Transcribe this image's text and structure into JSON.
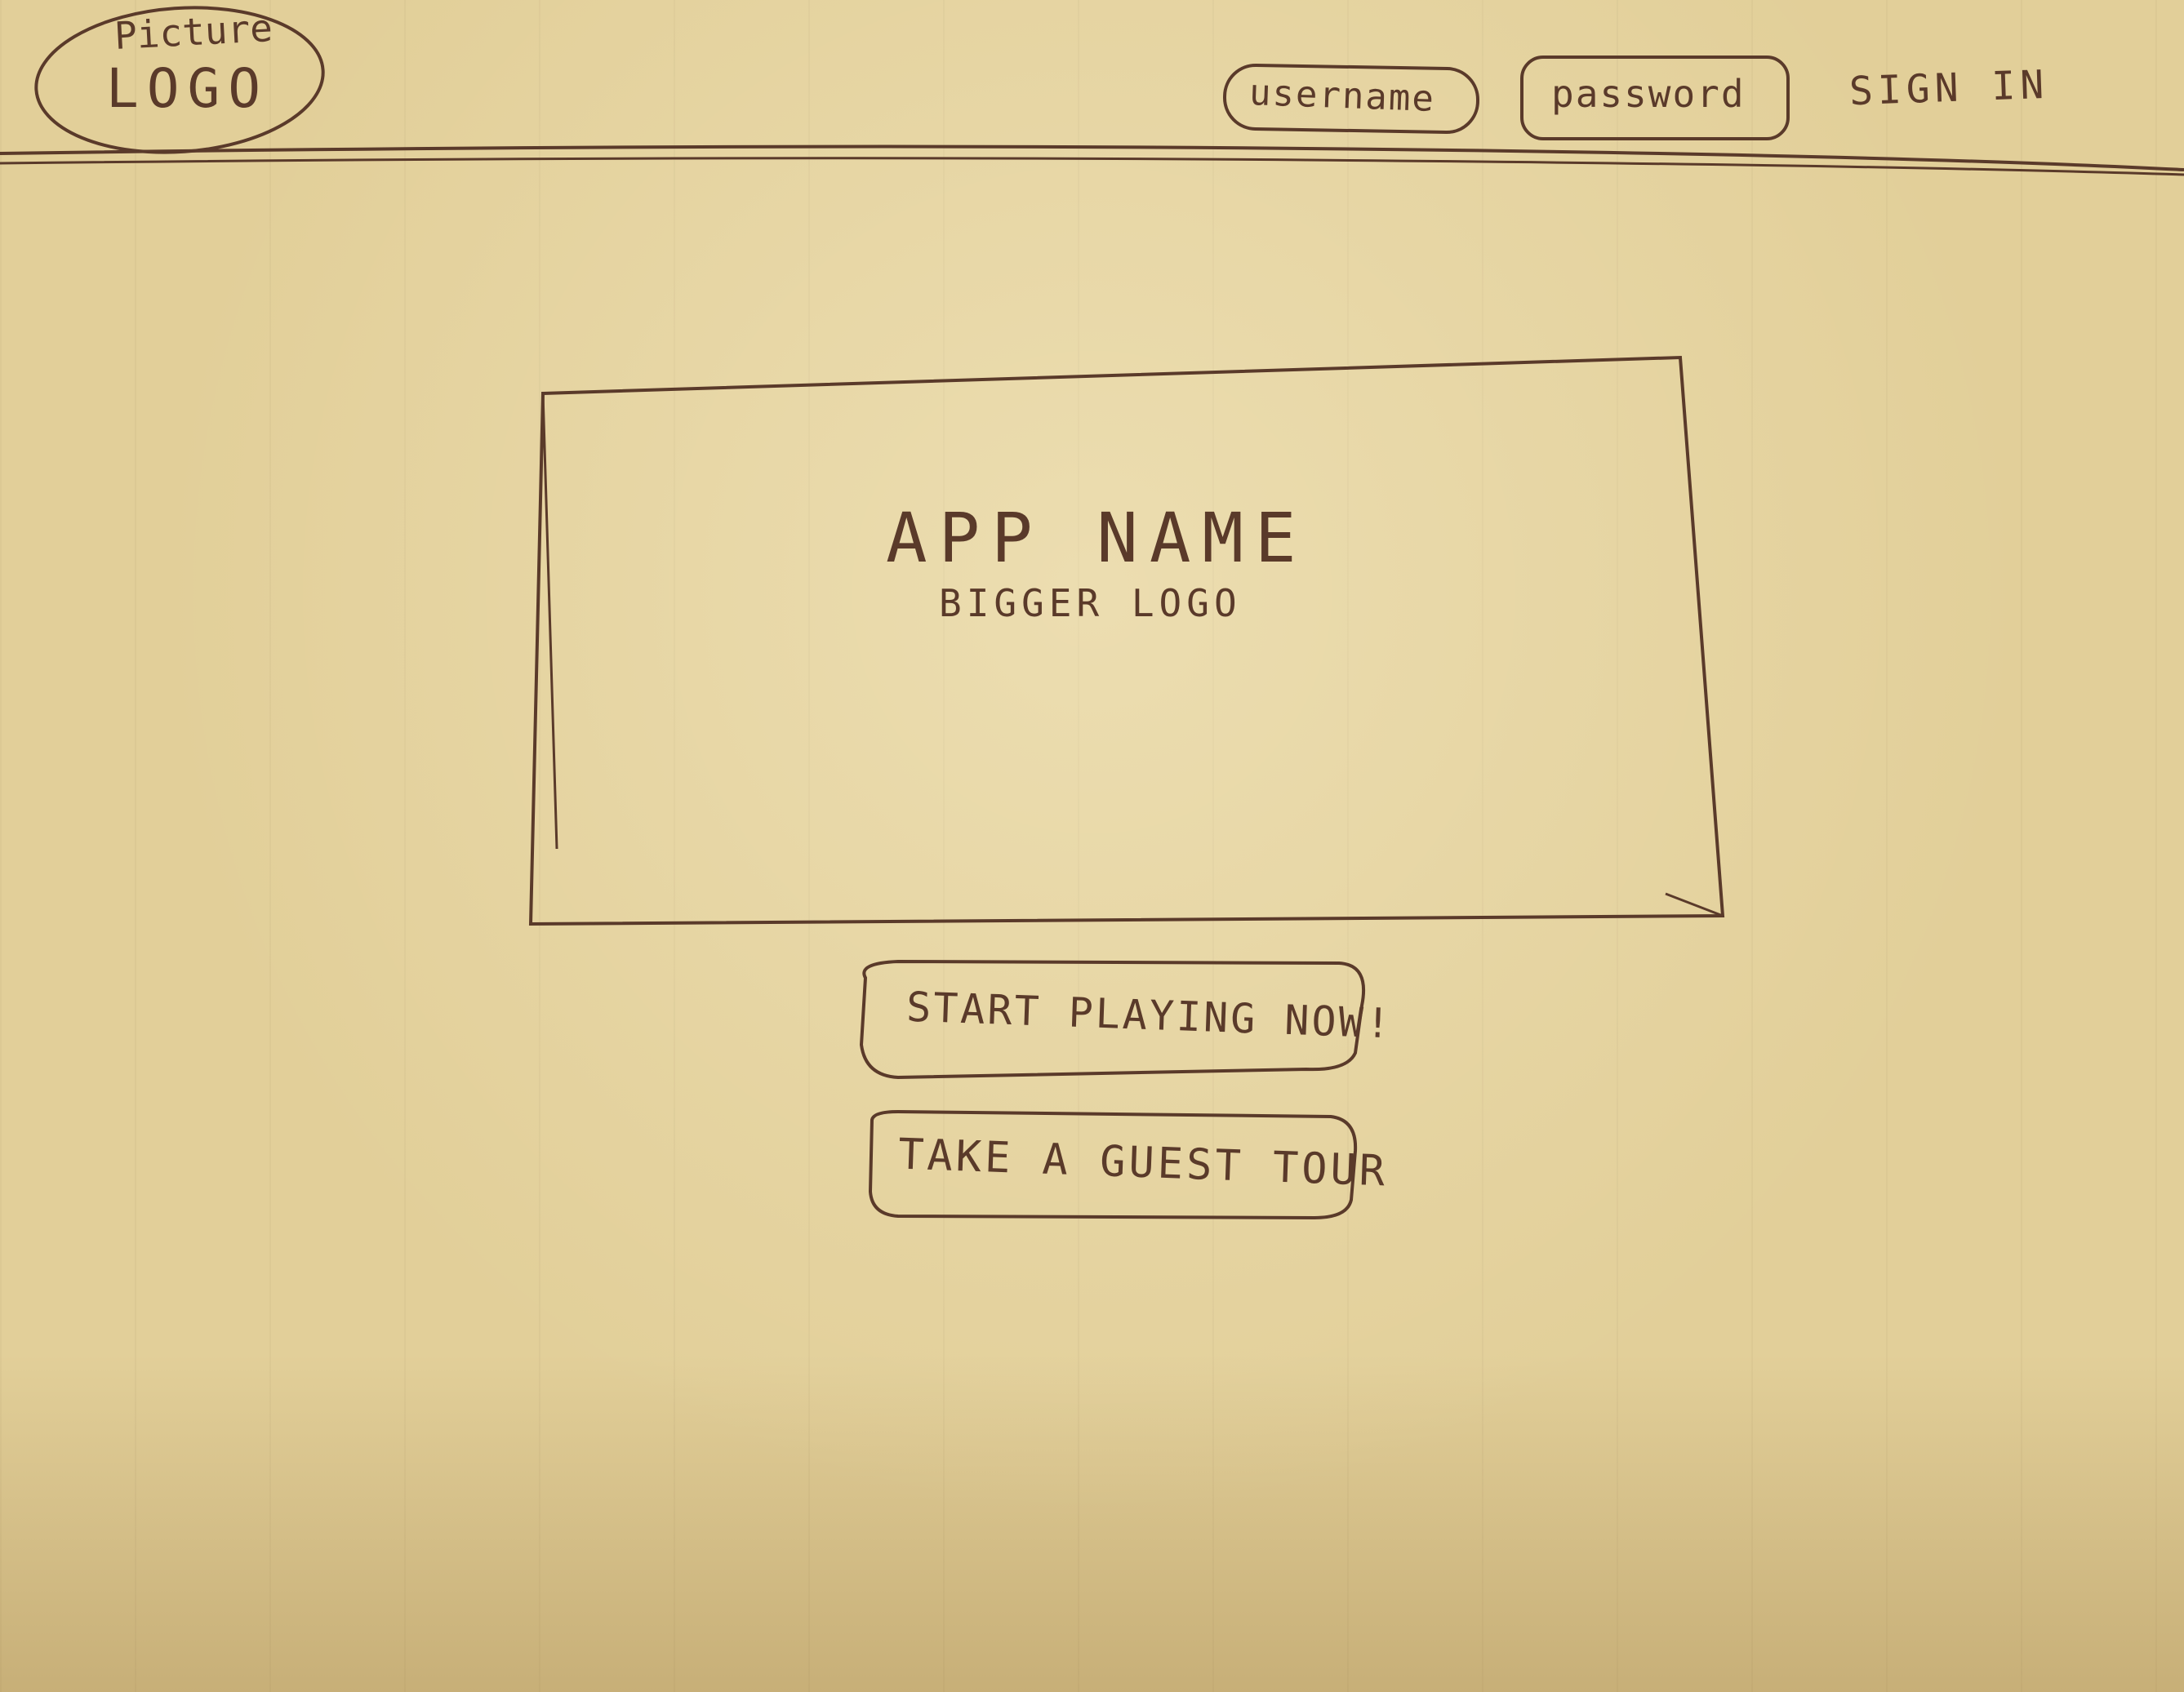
{
  "header": {
    "logo_caption": "Picture",
    "logo_text": "LOGO",
    "username_placeholder": "username",
    "password_placeholder": "password",
    "sign_in_label": "SIGN IN"
  },
  "hero": {
    "app_name": "APP NAME",
    "subtitle": "BIGGER LOGO"
  },
  "actions": {
    "start_label": "START PLAYING NOW!",
    "tour_label": "TAKE A GUEST TOUR"
  },
  "colors": {
    "paper": "#e2cf99",
    "ink": "#5a3a2a"
  }
}
